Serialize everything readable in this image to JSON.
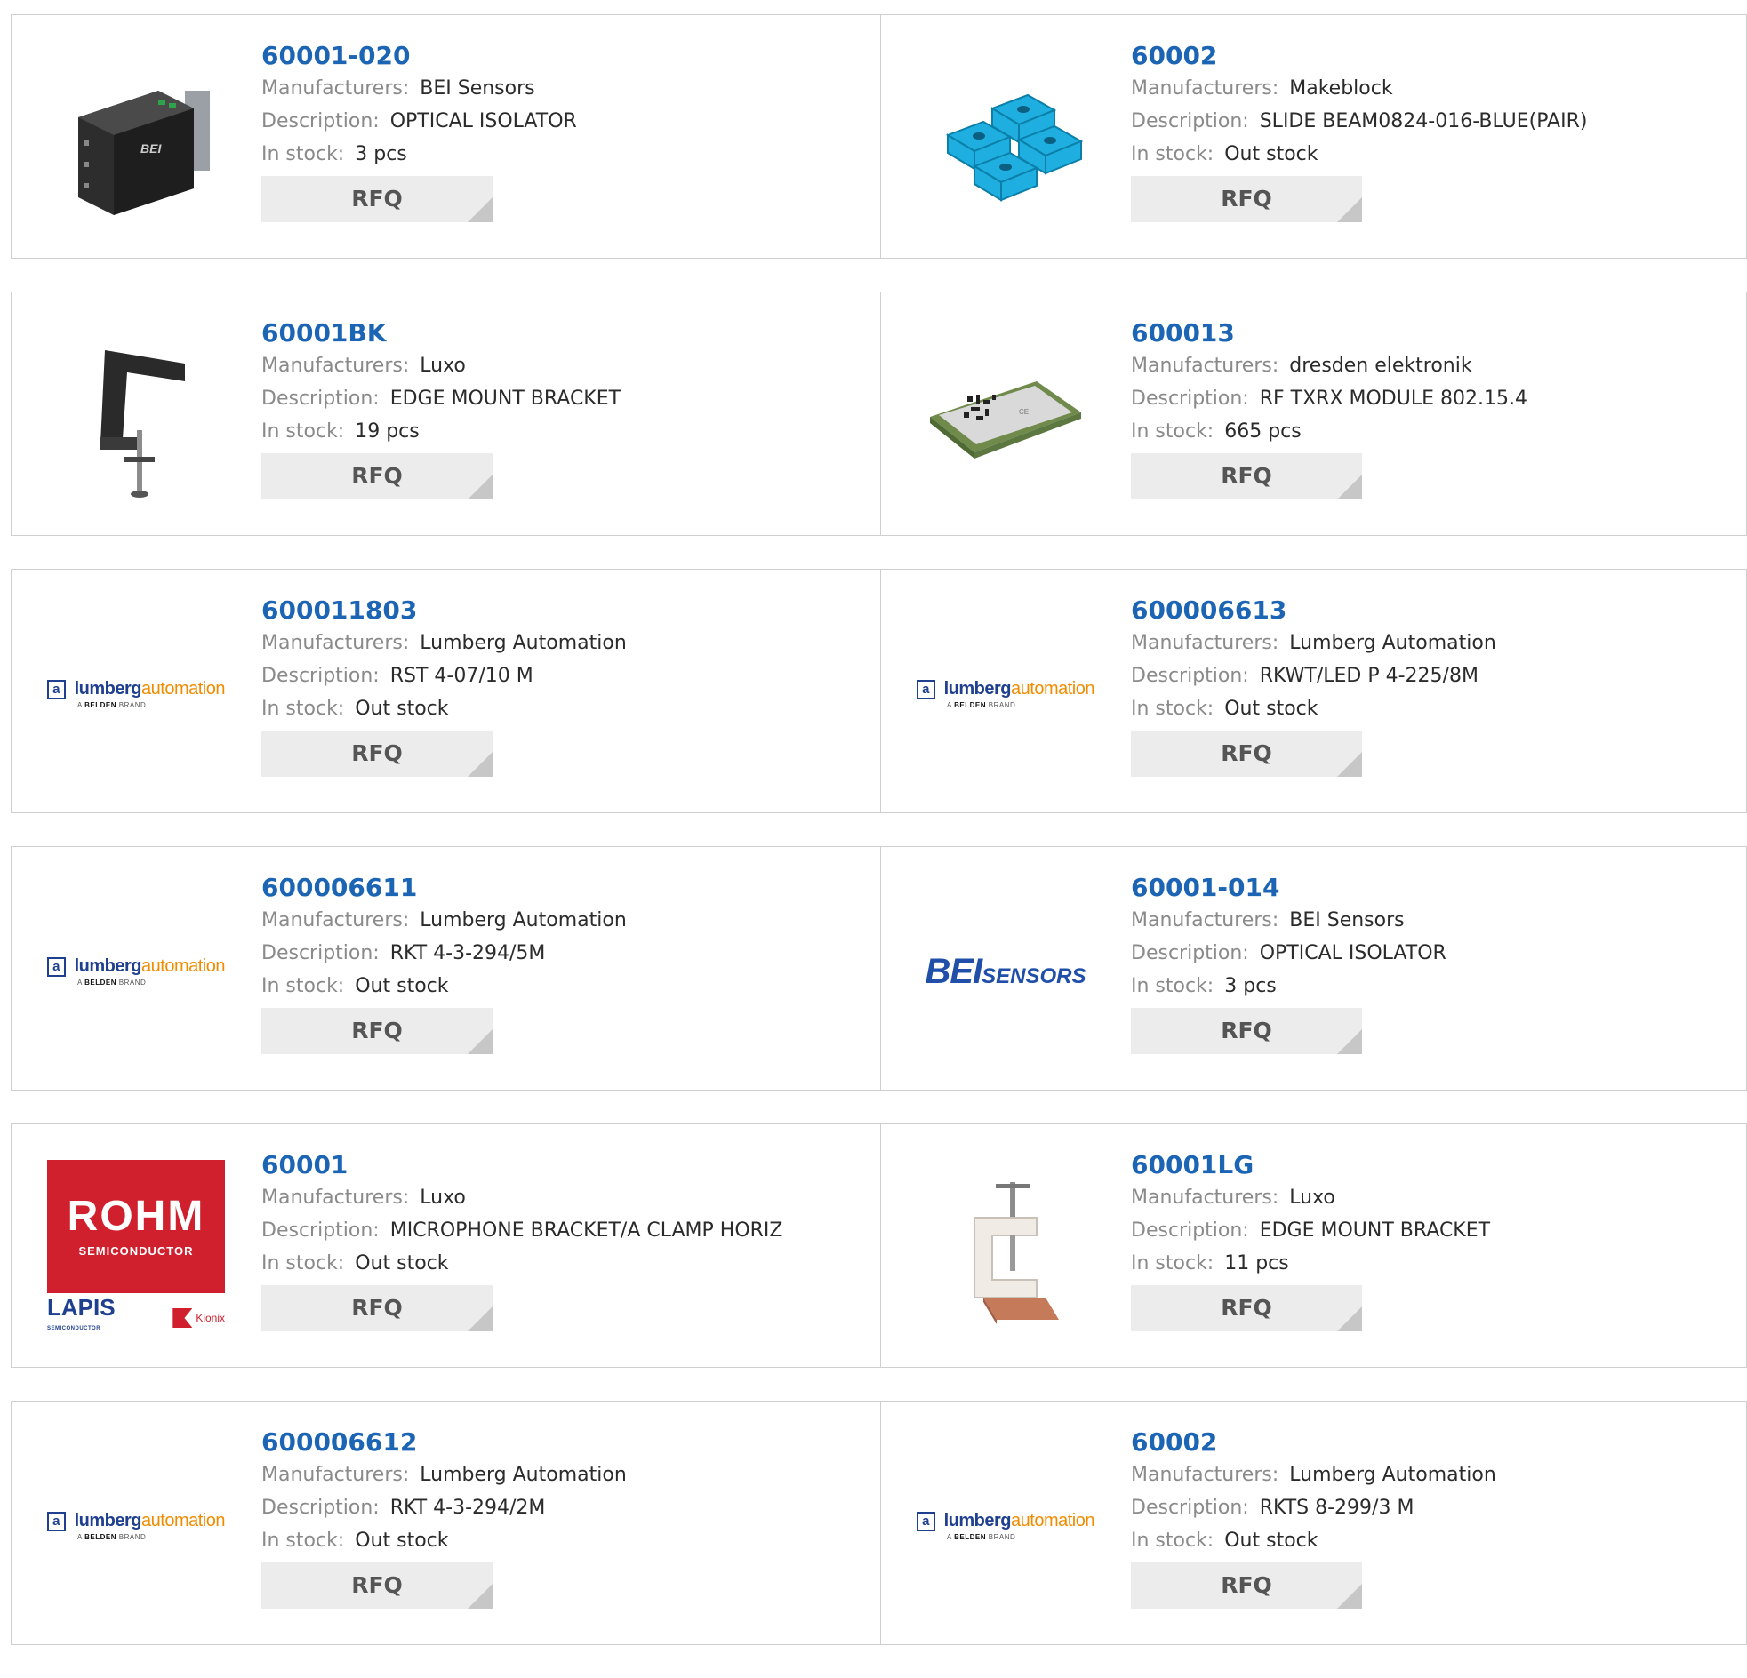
{
  "labels": {
    "manufacturers": "Manufacturers:",
    "description": "Description:",
    "in_stock": "In stock:",
    "rfq": "RFQ"
  },
  "colors": {
    "part_link": "#1c64b4",
    "label": "#8a8a8a",
    "value": "#2b2b2b",
    "rfq_bg": "#ececec",
    "border": "#cfcfcf"
  },
  "logo_text": {
    "lumberg_a": "a",
    "lumberg_1": "lumberg",
    "lumberg_2": "automation",
    "lumberg_sub_1": "A ",
    "lumberg_sub_2": "BELDEN",
    "lumberg_sub_3": " BRAND",
    "bei_1": "BEI",
    "bei_2": "SENSORS",
    "rohm_1": "ROHM",
    "rohm_2": "SEMICONDUCTOR",
    "lapis_1": "LAPIS",
    "lapis_2": "SEMICONDUCTOR",
    "kionix": "Kionix"
  },
  "products": [
    {
      "part": "60001-020",
      "manufacturer": "BEI Sensors",
      "description": "OPTICAL ISOLATOR",
      "stock": "3 pcs",
      "image": "isolator-module"
    },
    {
      "part": "60002",
      "manufacturer": "Makeblock",
      "description": "SLIDE BEAM0824-016-BLUE(PAIR)",
      "stock": "Out stock",
      "image": "blue-slide-blocks"
    },
    {
      "part": "60001BK",
      "manufacturer": "Luxo",
      "description": "EDGE MOUNT BRACKET",
      "stock": "19 pcs",
      "image": "black-clamp"
    },
    {
      "part": "600013",
      "manufacturer": "dresden elektronik",
      "description": "RF TXRX MODULE 802.15.4",
      "stock": "665 pcs",
      "image": "rf-module"
    },
    {
      "part": "600011803",
      "manufacturer": "Lumberg Automation",
      "description": "RST 4-07/10 M",
      "stock": "Out stock",
      "image": "lumberg-logo"
    },
    {
      "part": "600006613",
      "manufacturer": "Lumberg Automation",
      "description": "RKWT/LED P 4-225/8M",
      "stock": "Out stock",
      "image": "lumberg-logo"
    },
    {
      "part": "600006611",
      "manufacturer": "Lumberg Automation",
      "description": "RKT 4-3-294/5M",
      "stock": "Out stock",
      "image": "lumberg-logo"
    },
    {
      "part": "60001-014",
      "manufacturer": "BEI Sensors",
      "description": "OPTICAL ISOLATOR",
      "stock": "3 pcs",
      "image": "bei-logo"
    },
    {
      "part": "60001",
      "manufacturer": "Luxo",
      "description": "MICROPHONE BRACKET/A CLAMP HORIZ",
      "stock": "Out stock",
      "image": "rohm-logo"
    },
    {
      "part": "60001LG",
      "manufacturer": "Luxo",
      "description": "EDGE MOUNT BRACKET",
      "stock": "11 pcs",
      "image": "white-clamp"
    },
    {
      "part": "600006612",
      "manufacturer": "Lumberg Automation",
      "description": "RKT 4-3-294/2M",
      "stock": "Out stock",
      "image": "lumberg-logo"
    },
    {
      "part": "60002",
      "manufacturer": "Lumberg Automation",
      "description": "RKTS 8-299/3 M",
      "stock": "Out stock",
      "image": "lumberg-logo"
    }
  ]
}
